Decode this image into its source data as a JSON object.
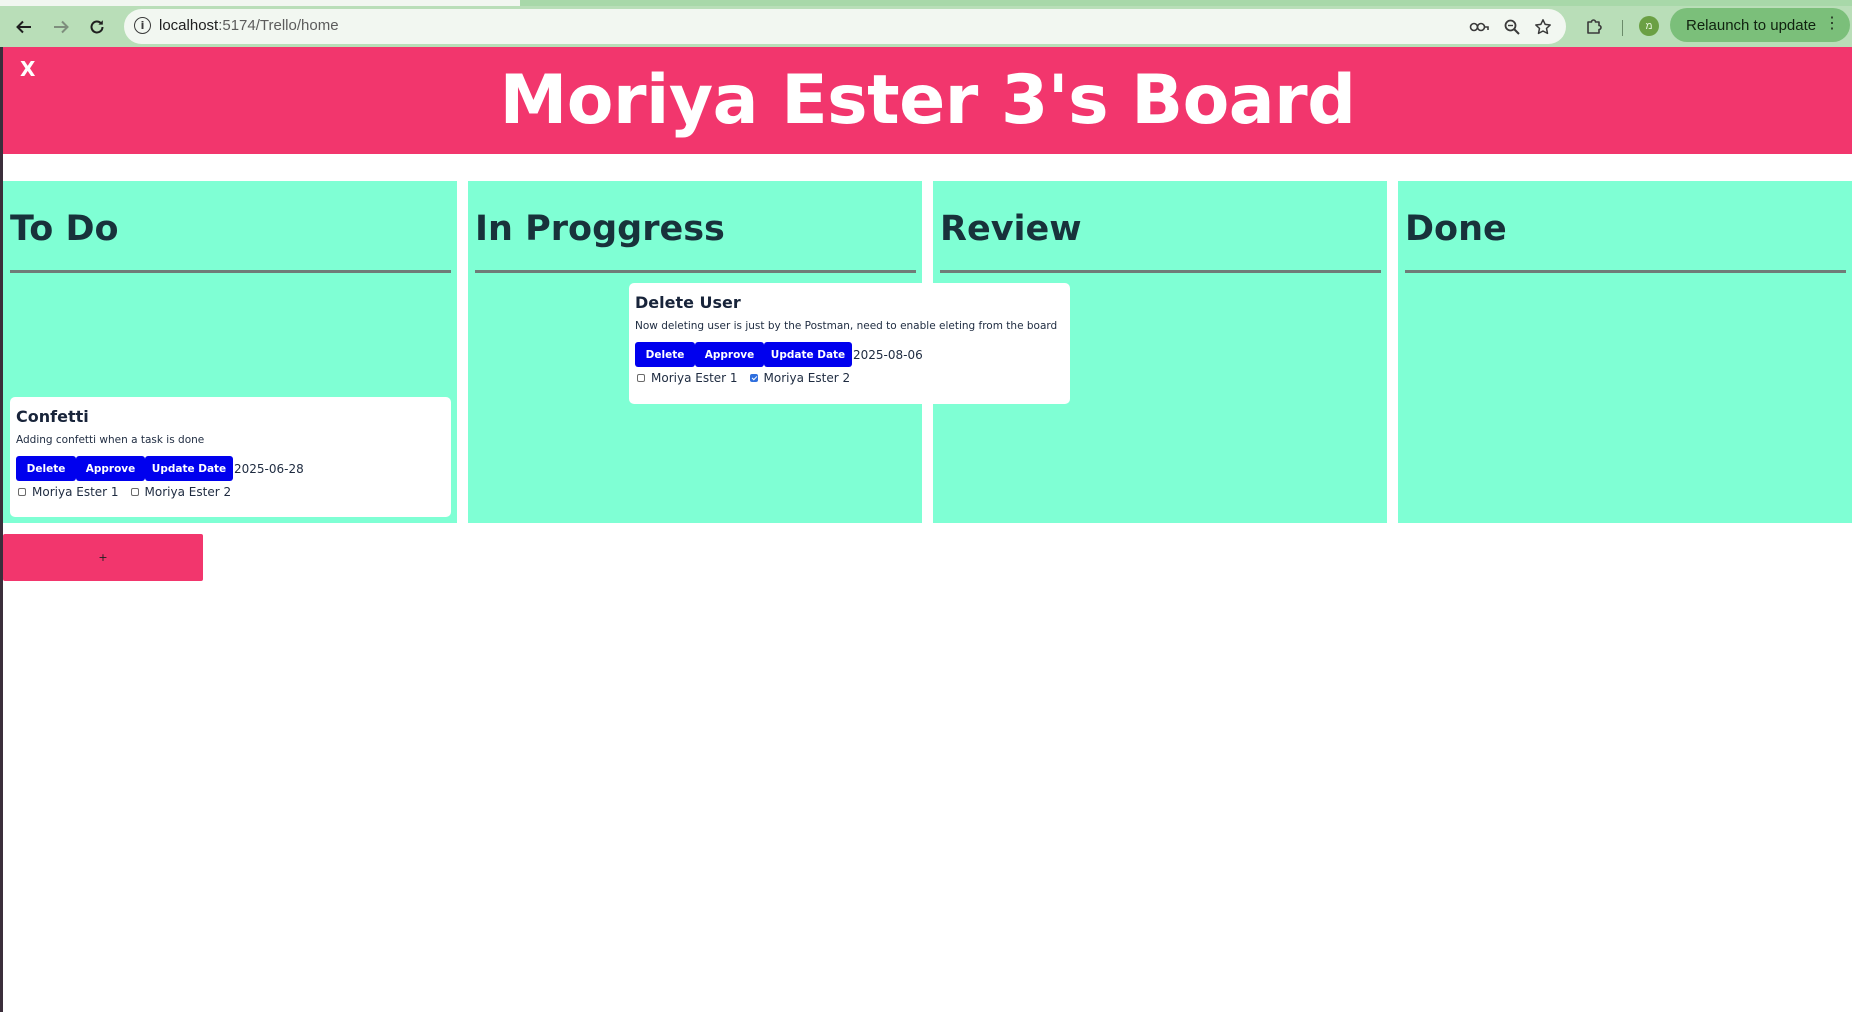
{
  "browser": {
    "url_host": "localhost",
    "url_path": ":5174/Trello/home",
    "relaunch_label": "Relaunch to update",
    "profile_initial": "מ",
    "icons": {
      "back": "back-arrow-icon",
      "forward": "forward-arrow-icon",
      "reload": "reload-icon",
      "site_info": "info-icon",
      "password": "key-icon",
      "zoom": "zoom-icon",
      "bookmark": "star-icon",
      "extensions": "puzzle-icon",
      "menu": "kebab-menu-icon"
    }
  },
  "board": {
    "close_label": "X",
    "title": "Moriya Ester 3's Board",
    "add_button_label": "+",
    "colors": {
      "header": "#f2366d",
      "column": "#7fffd4",
      "button": "#0000ee",
      "add_button": "#f2366d"
    },
    "columns": [
      {
        "title": "To Do"
      },
      {
        "title": "In Proggress"
      },
      {
        "title": "Review"
      },
      {
        "title": "Done"
      }
    ],
    "tasks": [
      {
        "title": "Confetti",
        "description": "Adding confetti when a task is done",
        "delete_label": "Delete",
        "approve_label": "Approve",
        "update_label": "Update Date",
        "date": "2025-06-28",
        "assignees": [
          {
            "name": "Moriya Ester 1",
            "checked": false
          },
          {
            "name": "Moriya Ester 2",
            "checked": false
          }
        ]
      },
      {
        "title": "Delete User",
        "description": "Now deleting user is just by the Postman, need to enable eleting from the board",
        "delete_label": "Delete",
        "approve_label": "Approve",
        "update_label": "Update Date",
        "date": "2025-08-06",
        "assignees": [
          {
            "name": "Moriya Ester 1",
            "checked": false
          },
          {
            "name": "Moriya Ester 2",
            "checked": true
          }
        ]
      }
    ]
  }
}
